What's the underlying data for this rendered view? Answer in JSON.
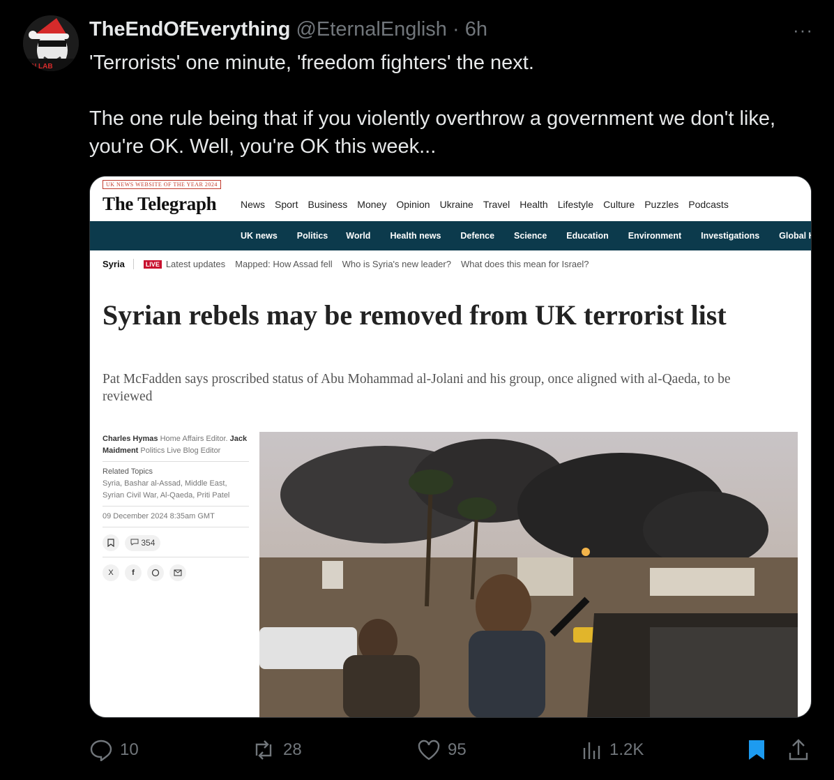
{
  "tweet": {
    "display_name": "TheEndOfEverything",
    "handle": "@EternalEnglish",
    "separator": "·",
    "time": "6h",
    "more_label": "···",
    "avatar_badge_text": "N LAB",
    "text": "'Terrorists' one minute, 'freedom fighters' the next.\n\nThe one rule being that if you violently overthrow a government we don't like, you're OK. Well, you're OK this week..."
  },
  "article": {
    "award": "UK NEWS WEBSITE OF THE YEAR 2024",
    "logo": "The Telegraph",
    "main_nav": [
      "News",
      "Sport",
      "Business",
      "Money",
      "Opinion",
      "Ukraine",
      "Travel",
      "Health",
      "Lifestyle",
      "Culture",
      "Puzzles",
      "Podcasts"
    ],
    "sub_nav": [
      "UK news",
      "Politics",
      "World",
      "Health news",
      "Defence",
      "Science",
      "Education",
      "Environment",
      "Investigations",
      "Global Health Secu"
    ],
    "crumbs": {
      "topic": "Syria",
      "live_badge": "LIVE",
      "links": [
        "Latest updates",
        "Mapped: How Assad fell",
        "Who is Syria's new leader?",
        "What does this mean for Israel?"
      ]
    },
    "headline": "Syrian rebels may be removed from UK terrorist list",
    "standfirst": "Pat McFadden says proscribed status of Abu Mohammad al-Jolani and his group, once aligned with al-Qaeda, to be reviewed",
    "author1": "Charles Hymas",
    "author1_role": "Home Affairs Editor.",
    "author2": "Jack Maidment",
    "author2_role": "Politics Live Blog Editor",
    "related_label": "Related Topics",
    "related_topics": "Syria, Bashar al-Assad, Middle East, Syrian Civil War, Al-Qaeda, Priti Patel",
    "date": "09 December 2024 8:35am GMT",
    "comments": "354"
  },
  "actions": {
    "replies": "10",
    "reposts": "28",
    "likes": "95",
    "views": "1.2K"
  },
  "colors": {
    "background": "#000000",
    "muted": "#71767b",
    "bookmark_active": "#1d9bf0",
    "telegraph_nav": "#0c3a4c"
  }
}
